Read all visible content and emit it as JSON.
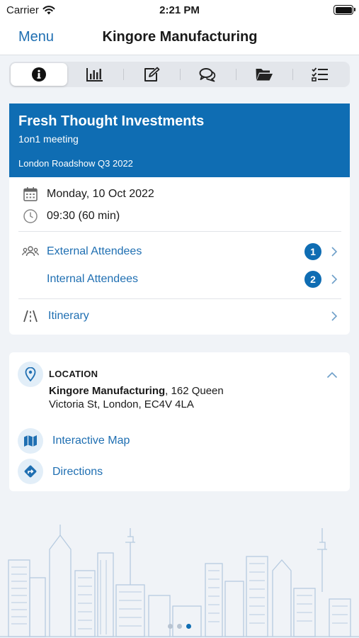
{
  "status": {
    "carrier": "Carrier",
    "time": "2:21 PM"
  },
  "nav": {
    "menu_label": "Menu",
    "title": "Kingore Manufacturing"
  },
  "tabs": [
    {
      "icon": "info-icon",
      "active": true
    },
    {
      "icon": "bar-chart-icon",
      "active": false
    },
    {
      "icon": "edit-icon",
      "active": false
    },
    {
      "icon": "chat-icon",
      "active": false
    },
    {
      "icon": "folder-icon",
      "active": false
    },
    {
      "icon": "checklist-icon",
      "active": false
    }
  ],
  "meeting": {
    "title": "Fresh Thought Investments",
    "type": "1on1 meeting",
    "event": "London Roadshow Q3 2022",
    "date": "Monday, 10 Oct 2022",
    "time": "09:30 (60 min)",
    "external_attendees": {
      "label": "External Attendees",
      "count": "1"
    },
    "internal_attendees": {
      "label": "Internal Attendees",
      "count": "2"
    },
    "itinerary_label": "Itinerary"
  },
  "location": {
    "label": "LOCATION",
    "venue": "Kingore Manufacturing",
    "address": ", 162 Queen Victoria St, London, EC4V 4LA",
    "interactive_map_label": "Interactive Map",
    "directions_label": "Directions"
  },
  "pager": {
    "total": 3,
    "current": 3
  },
  "colors": {
    "accent": "#0f6db3",
    "link": "#1f6fb2",
    "background": "#f0f3f7"
  }
}
